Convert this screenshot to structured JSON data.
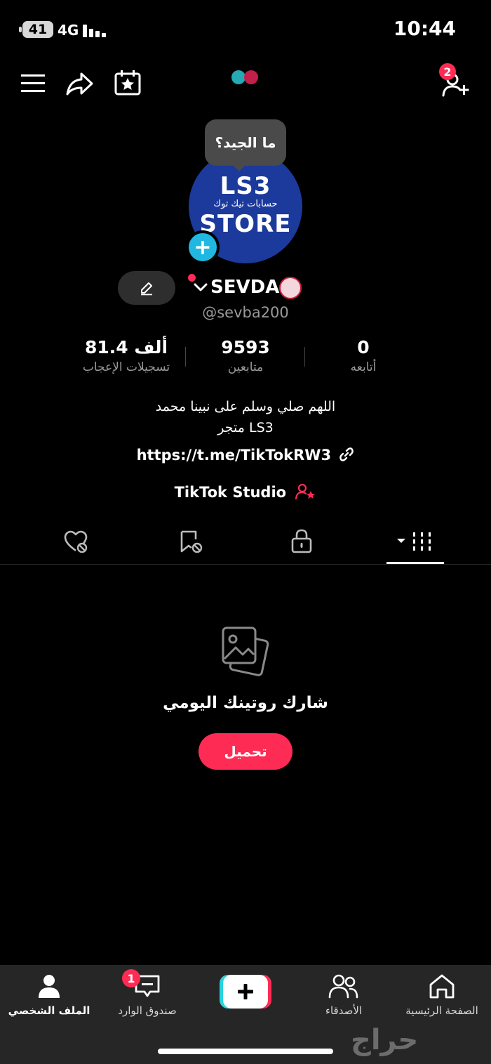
{
  "status_bar": {
    "battery": "41",
    "network": "4G",
    "time": "10:44"
  },
  "top_nav": {
    "follow_requests_badge": "2"
  },
  "profile": {
    "tooltip": "ما الجيد؟",
    "avatar_text_top": "LS3",
    "avatar_text_mid": "حسابات تيك توك",
    "avatar_text_bottom": "STORE",
    "display_name": "SEVDA",
    "username": "@sevba200"
  },
  "stats": [
    {
      "value": "81.4 ألف",
      "label": "تسجيلات الإعجاب"
    },
    {
      "value": "9593",
      "label": "متابعين"
    },
    {
      "value": "0",
      "label": "أتابعه"
    }
  ],
  "bio": {
    "line1": "اللهم صلي وسلم على نبينا محمد",
    "line2": "متجر LS3",
    "link": "https://t.me/TikTokRW3",
    "studio": "TikTok Studio"
  },
  "empty_state": {
    "title": "شارك روتينك اليومي",
    "button": "تحميل"
  },
  "bottom_nav": {
    "profile": "الملف الشخصي",
    "inbox": "صندوق الوارد",
    "inbox_badge": "1",
    "friends": "الأصدقاء",
    "home": "الصفحة الرئيسية"
  },
  "watermark": "حراج",
  "colors": {
    "accent": "#fe2c55",
    "cyan": "#20b8e0",
    "background": "#000000",
    "nav_bg": "#262626"
  }
}
